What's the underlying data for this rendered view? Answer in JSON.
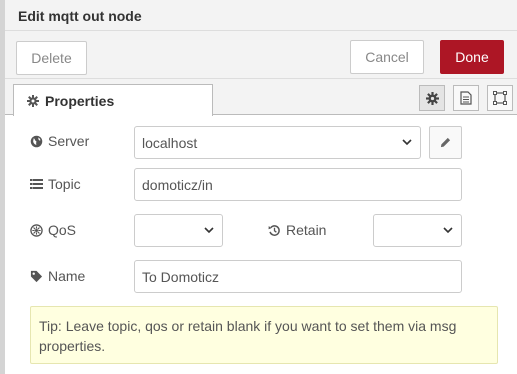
{
  "tray": {
    "title": "Edit mqtt out node"
  },
  "toolbar": {
    "delete_label": "Delete",
    "cancel_label": "Cancel",
    "done_label": "Done"
  },
  "tabs": {
    "properties_label": "Properties"
  },
  "form": {
    "server": {
      "label": "Server",
      "value": "localhost"
    },
    "topic": {
      "label": "Topic",
      "value": "domoticz/in"
    },
    "qos": {
      "label": "QoS",
      "value": ""
    },
    "retain": {
      "label": "Retain",
      "value": ""
    },
    "name": {
      "label": "Name",
      "value": "To Domoticz"
    }
  },
  "tip": {
    "text": "Tip: Leave topic, qos or retain blank if you want to set them via msg properties."
  },
  "colors": {
    "done_button": "#ad1625",
    "tip_background": "#ffffe0",
    "header_background": "#f3f3f3"
  },
  "icons": [
    "gear-icon",
    "document-icon",
    "frame-icon",
    "globe-icon",
    "pencil-icon",
    "list-icon",
    "qos-icon",
    "history-icon",
    "tag-icon",
    "chevron-down-icon"
  ]
}
